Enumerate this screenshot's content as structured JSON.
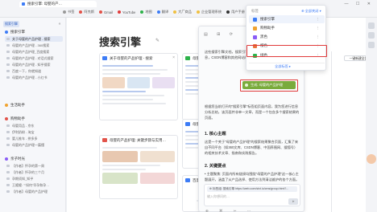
{
  "window": {
    "tab_title": "搜索引擎: 母婴的产…",
    "controls": "— ☐ ✕"
  },
  "bookmarks": [
    "书签",
    "阿克斯",
    "Gmail",
    "YouTube",
    "地图",
    "翻译",
    "大厂商品",
    "企业管理系统",
    "用户手册"
  ],
  "sidebar": {
    "home_label": "搜索引擎",
    "collapse_icon": "«",
    "groups": [
      {
        "label": "搜索引擎",
        "color": "#3d7cf6",
        "items": [
          "关于母婴的产品护理 - 搜索",
          "母婴的产品护理 - 360搜索",
          "母婴的产品护理_百度搜索",
          "母婴的产品护理 - 对话式搜索",
          "母婴的产品护理 - 知乎搜索",
          "百度一下，你就知道",
          "母婴的产品护理 - 小红书"
        ]
      },
      {
        "label": "生活助手",
        "color": "#f0a330",
        "items": []
      },
      {
        "label": "购物助手",
        "color": "#e2534a",
        "items": [
          "母婴用品 - 京东",
          "伊利奶粉 - 淘宝",
          "婴儿推车 - 拼多多",
          "母婴的产品护理一篇懂"
        ]
      },
      {
        "label": "亲子时光",
        "color": "#8a5cf6",
        "items": [
          "【作者】怀孕的第一周",
          "【作者】怀孕的三个月",
          "孕期须知_知乎",
          "王嬷嬷: \"“如何”早孕和孕…",
          "【作者】母婴的产品护理"
        ]
      }
    ]
  },
  "main": {
    "engine_title": "搜索引擎",
    "edit_icon": "✎",
    "new_all_label": "一键新建全部",
    "cards": [
      {
        "title": "关于母婴的产品护理 - 搜索",
        "logo_color": "#3d7cf6"
      },
      {
        "title": "母婴的产品护理 - 360搜索",
        "logo_color": "#2db24a"
      },
      {
        "title": "母婴的产品护理: 关键步骤与实用…",
        "logo_color": "#e2534a"
      },
      {
        "title": "母婴的产品护理_百度搜索",
        "logo_color": "#3d7cf6"
      },
      {
        "title": "百度一下，你就知道",
        "logo_color": "#3d7cf6"
      }
    ]
  },
  "panel": {
    "top_icons": "▤ ⊞ ⟳",
    "intro": "这些搜索引擎文档，搜索引擎提供了多种类型的资料和来源信息，CSDN博客和其他网站的详细报告。",
    "tag_label": "生成: 母婴的产品护理",
    "desc": "根据您当前打开的\"搜索引擎\"标签组页面内容，我为您进行信息分析总结，该页面并非单一文章，而是一个包含多个搜索结果的页面。",
    "h1": "1. 核心主题",
    "p1": "这是一个关于\"母婴的产品护理\"的搜索结果聚合页面，汇集了来自不同平台（如360文库、CSDN博客、中国养殖网、搜狐号）的相关技术文章、指南和实践报告。",
    "h2": "2. 关键要点",
    "p2": "• 主题聚焦: 页面内所有链接均围绕\"母婴的产品护理\"这一核心主题展开，涵盖了从产品选择、使用方法到清洁维护的各个方面。",
    "link_chip": "⊕ 标签组: 搜索引擎   https://web.com/stxt.io/cms/group.html?...",
    "input_placeholder": "输入你想问的…",
    "send_icon": "➤",
    "tools": "⊕ ⌘ ✂ ⋯"
  },
  "dropdown": {
    "title": "标签",
    "close_label": "⊕ 全部关闭 ▾",
    "items": [
      {
        "label": "搜索引擎",
        "color": "#3d7cf6",
        "selected": true
      },
      {
        "label": "购物助手",
        "color": "#f0a330",
        "selected": false
      },
      {
        "label": "黑色",
        "color": "#8a5cf6",
        "selected": false
      },
      {
        "label": "橙色",
        "color": "#e8723a",
        "selected": false
      },
      {
        "label": "绿色",
        "color": "#2db24a",
        "selected": false
      }
    ],
    "more_icon": "⋮",
    "all_label": "全部标签 ▸"
  },
  "colors": {
    "accent": "#3d7cf6",
    "highlight_box": "#e03a3a",
    "tag_green": "#7aab3c"
  }
}
